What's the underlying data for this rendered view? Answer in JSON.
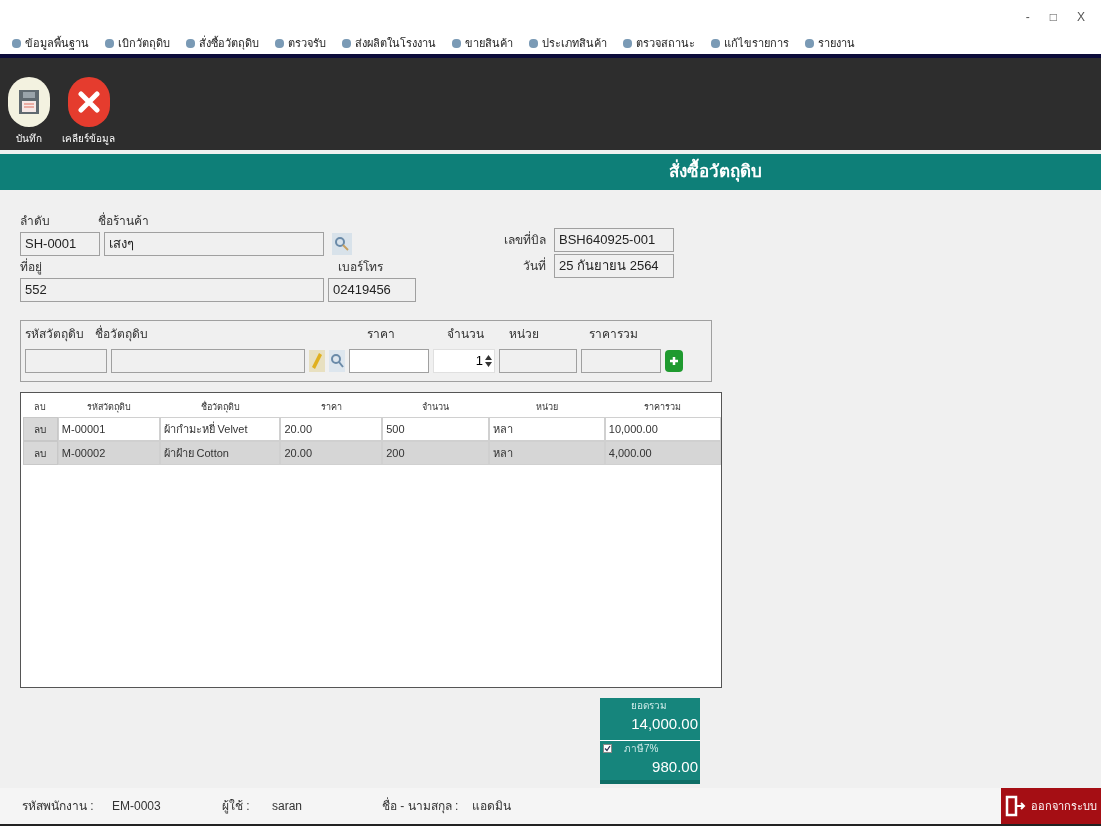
{
  "window": {
    "controls": [
      "-",
      "□",
      "X"
    ]
  },
  "menu": [
    {
      "label": "ข้อมูลพื้นฐาน"
    },
    {
      "label": "เบิกวัตถุดิบ"
    },
    {
      "label": "สั่งซื้อวัตถุดิบ"
    },
    {
      "label": "ตรวจรับ"
    },
    {
      "label": "ส่งผลิตในโรงงาน"
    },
    {
      "label": "ขายสินค้า"
    },
    {
      "label": "ประเภทสินค้า"
    },
    {
      "label": "ตรวจสถานะ"
    },
    {
      "label": "แก้ไขรายการ"
    },
    {
      "label": "รายงาน"
    }
  ],
  "toolbar": [
    {
      "kind": "save",
      "label": "บันทึก"
    },
    {
      "kind": "clear",
      "label": "เคลียร์ข้อมูล"
    }
  ],
  "header": {
    "title": "สั่งซื้อวัตถุดิบ"
  },
  "form": {
    "order_label": "ลำดับ",
    "order_value": "SH-0001",
    "shop_label": "ชื่อร้านค้า",
    "shop_value": "เสงๆ",
    "address_label": "ที่อยู่",
    "address_value": "552",
    "phone_label": "เบอร์โทร",
    "phone_value": "02419456",
    "bill_label": "เลขที่บิล",
    "bill_value": "BSH640925-001",
    "date_label": "วันที่",
    "date_value": "25 กันยายน 2564"
  },
  "entry": {
    "code_label": "รหัสวัตถุดิบ",
    "name_label": "ชื่อวัตถุดิบ",
    "price_label": "ราคา",
    "qty_label": "จำนวน",
    "qty_value": "1",
    "unit_label": "หน่วย",
    "total_label": "ราคารวม"
  },
  "table": {
    "columns": [
      "ลบ",
      "รหัสวัตถุดิบ",
      "ชื่อวัตถุดิบ",
      "ราคา",
      "จำนวน",
      "หน่วย",
      "ราคารวม"
    ],
    "rows": [
      {
        "selected": false,
        "cells": [
          "ลบ",
          "M-00001",
          "ผ้ากำมะหยี่ Velvet",
          "20.00",
          "500",
          "หลา",
          "10,000.00"
        ]
      },
      {
        "selected": true,
        "cells": [
          "ลบ",
          "M-00002",
          "ผ้าฝ้าย Cotton",
          "20.00",
          "200",
          "หลา",
          "4,000.00"
        ]
      }
    ]
  },
  "totals": {
    "sum_label": "ยอดรวม",
    "sum_value": "14,000.00",
    "vat_label": "ภาษี7%",
    "vat_checked": true,
    "vat_value": "980.00"
  },
  "status_bar": {
    "employee_label": "รหัสพนักงาน :",
    "employee_value": "EM-0003",
    "user_label": "ผู้ใช้ :",
    "user_value": "saran",
    "name_label": "ชื่อ - นามสกุล :",
    "name_value": "แอดมิน",
    "logout": "ออกจากระบบ"
  }
}
